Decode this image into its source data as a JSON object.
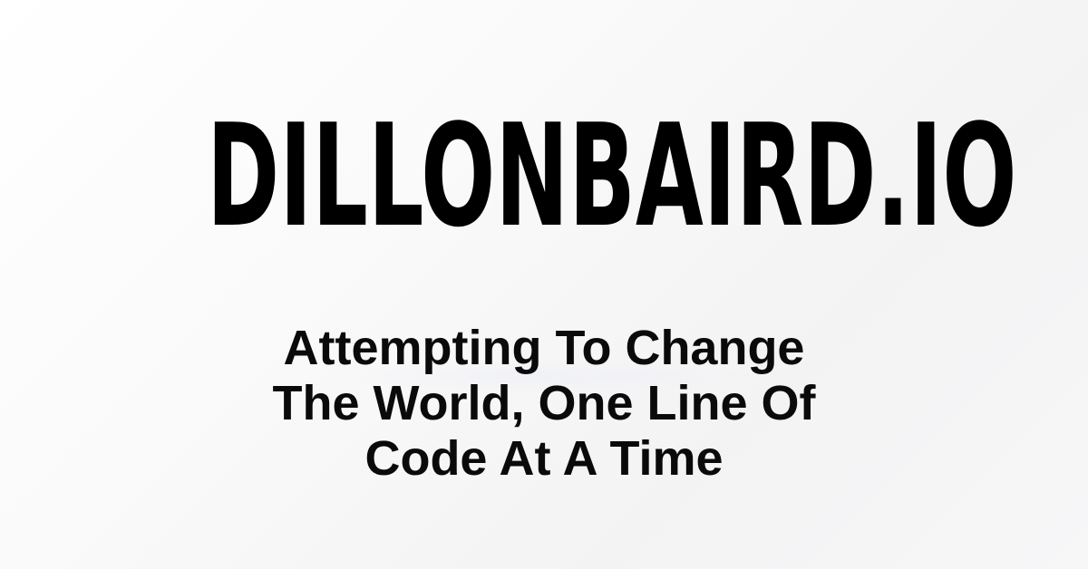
{
  "site": {
    "title": "DILLONBAIRD.IO",
    "tagline_lines": [
      "Attempting To Change",
      "The World, One Line Of",
      "Code At A Time"
    ]
  },
  "colors": {
    "text": "#000000",
    "background": "#f7f7f7"
  }
}
